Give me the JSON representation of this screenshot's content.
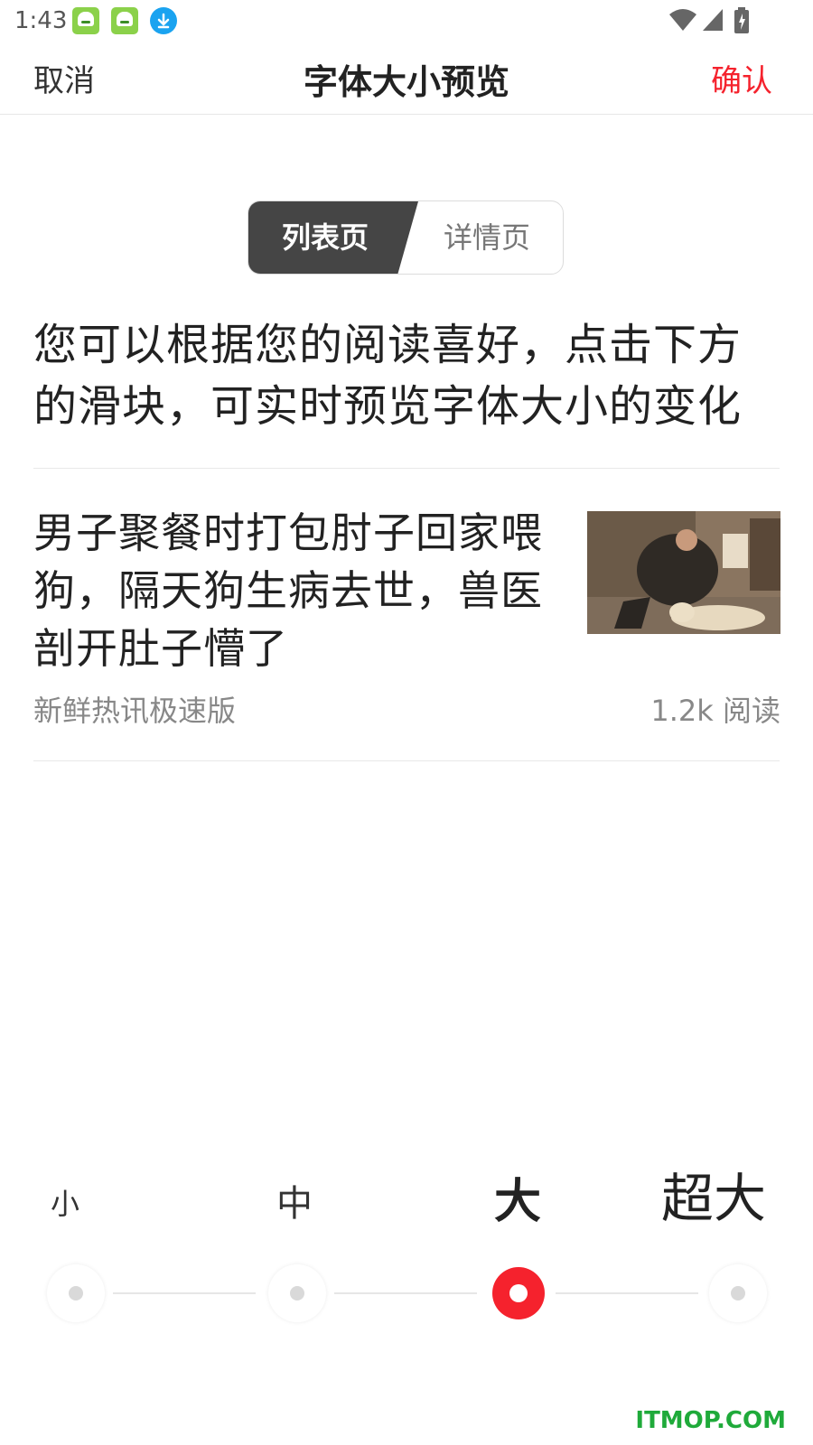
{
  "status_bar": {
    "time": "1:43",
    "notification_icons": [
      "app-notification-icon",
      "app-notification-icon",
      "download-icon"
    ],
    "right_icons": [
      "wifi-icon",
      "cell-signal-icon",
      "battery-icon"
    ]
  },
  "nav": {
    "cancel": "取消",
    "title": "字体大小预览",
    "confirm": "确认",
    "confirm_color": "#f5222d"
  },
  "tabs": {
    "list": "列表页",
    "detail": "详情页",
    "active": "列表页"
  },
  "tip": "您可以根据您的阅读喜好，点击下方的滑块，可实时预览字体大小的变化",
  "article": {
    "title": "男子聚餐时打包肘子回家喂狗，隔天狗生病去世，兽医剖开肚子懵了",
    "source": "新鲜热讯极速版",
    "reads": "1.2k 阅读"
  },
  "font_sizes": {
    "options": [
      "小",
      "中",
      "大",
      "超大"
    ],
    "selected": "大",
    "accent_color": "#f5222d"
  },
  "watermark": "ITMOP.COM"
}
